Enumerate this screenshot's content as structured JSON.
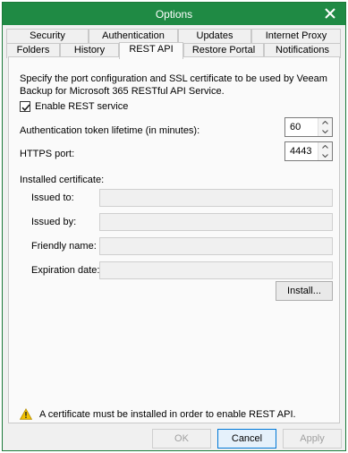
{
  "window": {
    "title": "Options"
  },
  "tabs": {
    "row_back": [
      {
        "label": "Security"
      },
      {
        "label": "Authentication"
      },
      {
        "label": "Updates"
      },
      {
        "label": "Internet Proxy"
      }
    ],
    "row_front": [
      {
        "label": "Folders"
      },
      {
        "label": "History"
      },
      {
        "label": "REST API",
        "active": true
      },
      {
        "label": "Restore Portal"
      },
      {
        "label": "Notifications"
      }
    ]
  },
  "rest_api": {
    "description": "Specify the port configuration and SSL certificate to be used by Veeam Backup for Microsoft 365 RESTful API Service.",
    "enable_label": "Enable REST service",
    "enable_checked": true,
    "token_lifetime_label": "Authentication token lifetime (in minutes):",
    "token_lifetime_value": "60",
    "https_port_label": "HTTPS port:",
    "https_port_value": "4443",
    "installed_cert_label": "Installed certificate:",
    "issued_to_label": "Issued to:",
    "issued_to_value": "",
    "issued_by_label": "Issued by:",
    "issued_by_value": "",
    "friendly_name_label": "Friendly name:",
    "friendly_name_value": "",
    "expiration_label": "Expiration date:",
    "expiration_value": "",
    "install_button": "Install...",
    "warning_text": "A certificate must be installed in order to enable REST API."
  },
  "footer": {
    "ok": "OK",
    "cancel": "Cancel",
    "apply": "Apply"
  },
  "colors": {
    "titlebar": "#1f8a44",
    "warning_icon": "#f2c200"
  }
}
